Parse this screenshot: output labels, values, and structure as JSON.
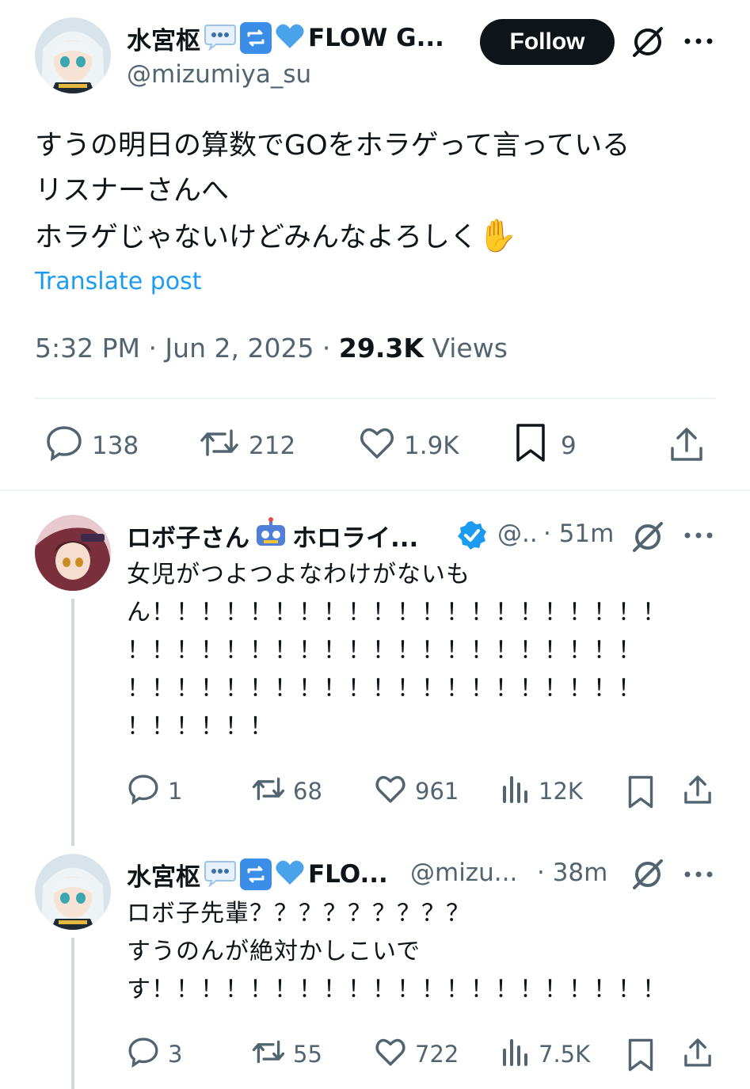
{
  "main_post": {
    "display_name": "水宮枢",
    "display_name_tail": "FLOW G...",
    "handle": "@mizumiya_su",
    "follow_label": "Follow",
    "text": "すうの明日の算数でGOをホラゲって言っている\nリスナーさんへ\nホラゲじゃないけどみんなよろしく",
    "emoji": "✋",
    "translate_label": "Translate post",
    "time": "5:32 PM · Jun 2, 2025 · ",
    "views_count": "29.3K",
    "views_label": " Views",
    "stats": {
      "replies": "138",
      "reposts": "212",
      "likes": "1.9K",
      "bookmarks": "9"
    }
  },
  "replies": [
    {
      "display_name": "ロボ子さん",
      "display_name_tail": "ホロライ...",
      "handle": "@..",
      "time": "· 51m",
      "text": "女児がつよつよなわけがないも\nん！！！！！！！！！！！！！！！！！！！！！\n！！！！！！！！！！！！！！！！！！！！！\n！！！！！！！！！！！！！！！！！！！！！\n！！！！！！",
      "stats": {
        "replies": "1",
        "reposts": "68",
        "likes": "961",
        "views": "12K"
      }
    },
    {
      "display_name": "水宮枢",
      "display_name_tail": "FLO...",
      "handle": "@mizu...",
      "time": "· 38m",
      "text": "ロボ子先輩？？？？？？？？？\nすうのんが絶対かしこいで\nす！！！！！！！！！！！！！！！！！！！！！",
      "stats": {
        "replies": "3",
        "reposts": "55",
        "likes": "722",
        "views": "7.5K"
      }
    }
  ],
  "colors": {
    "link": "#1d9bf0",
    "muted": "#536471",
    "verified": "#1d9bf0",
    "emoji_blue": "#3b8ee8"
  },
  "icons": [
    "speech-balloon-emoji",
    "repeat-emoji",
    "blue-heart-emoji",
    "robot-emoji",
    "raised-hand-emoji",
    "grok-icon",
    "more-icon",
    "reply-icon",
    "repost-icon",
    "like-icon",
    "bookmark-icon",
    "share-icon",
    "views-icon",
    "verified-badge-icon"
  ]
}
